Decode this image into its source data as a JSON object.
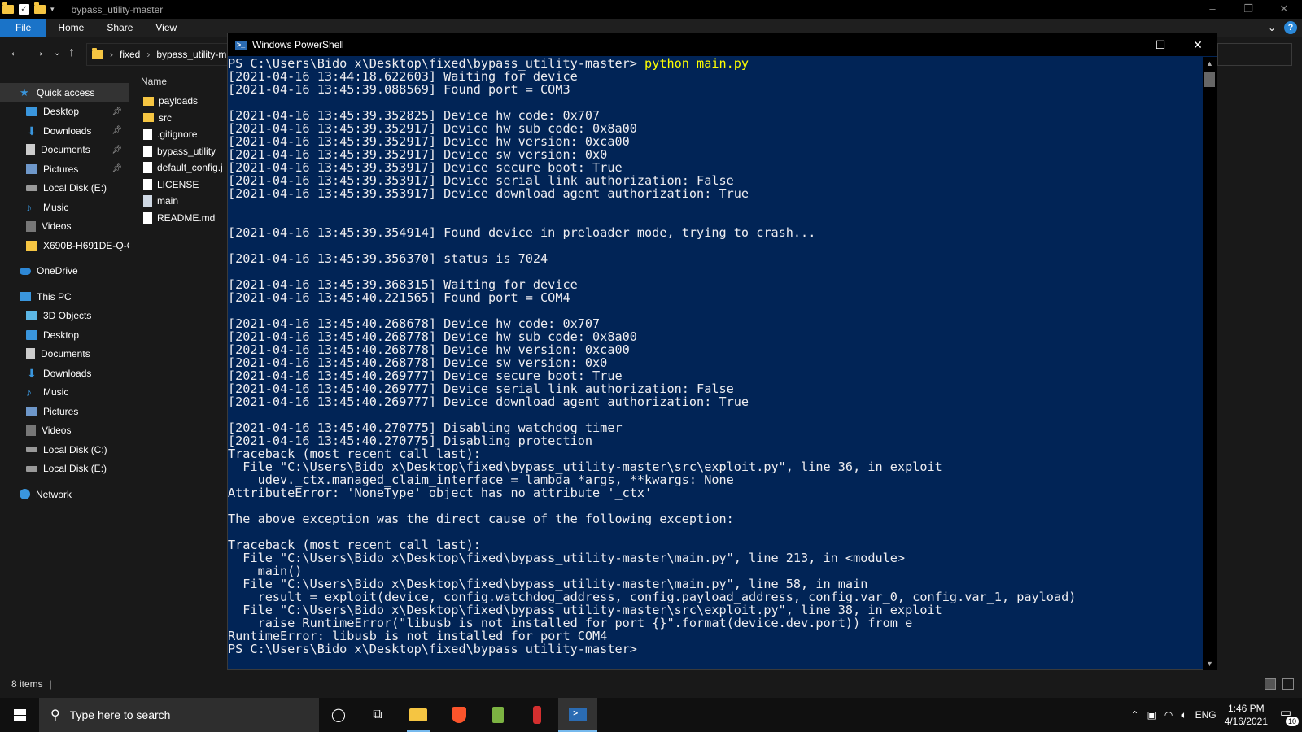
{
  "explorer": {
    "title": "bypass_utility-master",
    "tabs": [
      "File",
      "Home",
      "Share",
      "View"
    ],
    "breadcrumb": [
      "fixed",
      "bypass_utility-m"
    ],
    "column_header": "Name",
    "status_items": "8 items",
    "nav": [
      {
        "label": "Quick access",
        "icon": "star-icon",
        "top": true,
        "selected": true
      },
      {
        "label": "Desktop",
        "icon": "desktop-icon",
        "pin": true
      },
      {
        "label": "Downloads",
        "icon": "downloads-icon",
        "pin": true
      },
      {
        "label": "Documents",
        "icon": "documents-icon",
        "pin": true
      },
      {
        "label": "Pictures",
        "icon": "pictures-icon",
        "pin": true
      },
      {
        "label": "Local Disk (E:)",
        "icon": "disk-icon"
      },
      {
        "label": "Music",
        "icon": "music-icon"
      },
      {
        "label": "Videos",
        "icon": "videos-icon"
      },
      {
        "label": "X690B-H691DE-Q-G",
        "icon": "folder-icon"
      },
      {
        "gap": true
      },
      {
        "label": "OneDrive",
        "icon": "onedrive-icon",
        "top": true
      },
      {
        "gap": true
      },
      {
        "label": "This PC",
        "icon": "this-pc-icon",
        "top": true
      },
      {
        "label": "3D Objects",
        "icon": "3d-objects-icon"
      },
      {
        "label": "Desktop",
        "icon": "desktop-icon"
      },
      {
        "label": "Documents",
        "icon": "documents-icon"
      },
      {
        "label": "Downloads",
        "icon": "downloads-icon"
      },
      {
        "label": "Music",
        "icon": "music-icon"
      },
      {
        "label": "Pictures",
        "icon": "pictures-icon"
      },
      {
        "label": "Videos",
        "icon": "videos-icon"
      },
      {
        "label": "Local Disk (C:)",
        "icon": "disk-icon"
      },
      {
        "label": "Local Disk (E:)",
        "icon": "disk-icon"
      },
      {
        "gap": true
      },
      {
        "label": "Network",
        "icon": "network-icon",
        "top": true
      }
    ],
    "files": [
      {
        "name": "payloads",
        "icon": "folder-icon"
      },
      {
        "name": "src",
        "icon": "folder-icon"
      },
      {
        "name": ".gitignore",
        "icon": "file-icon"
      },
      {
        "name": "bypass_utility",
        "icon": "file-icon"
      },
      {
        "name": "default_config.j",
        "icon": "file-icon"
      },
      {
        "name": "LICENSE",
        "icon": "file-icon"
      },
      {
        "name": "main",
        "icon": "python-file-icon"
      },
      {
        "name": "README.md",
        "icon": "file-icon"
      }
    ]
  },
  "powershell": {
    "title": "Windows PowerShell",
    "prompt_path": "PS C:\\Users\\Bido x\\Desktop\\fixed\\bypass_utility-master> ",
    "command": "python main.py",
    "lines": [
      "[2021-04-16 13:44:18.622603] Waiting for device",
      "[2021-04-16 13:45:39.088569] Found port = COM3",
      "",
      "[2021-04-16 13:45:39.352825] Device hw code: 0x707",
      "[2021-04-16 13:45:39.352917] Device hw sub code: 0x8a00",
      "[2021-04-16 13:45:39.352917] Device hw version: 0xca00",
      "[2021-04-16 13:45:39.352917] Device sw version: 0x0",
      "[2021-04-16 13:45:39.353917] Device secure boot: True",
      "[2021-04-16 13:45:39.353917] Device serial link authorization: False",
      "[2021-04-16 13:45:39.353917] Device download agent authorization: True",
      "",
      "",
      "[2021-04-16 13:45:39.354914] Found device in preloader mode, trying to crash...",
      "",
      "[2021-04-16 13:45:39.356370] status is 7024",
      "",
      "[2021-04-16 13:45:39.368315] Waiting for device",
      "[2021-04-16 13:45:40.221565] Found port = COM4",
      "",
      "[2021-04-16 13:45:40.268678] Device hw code: 0x707",
      "[2021-04-16 13:45:40.268778] Device hw sub code: 0x8a00",
      "[2021-04-16 13:45:40.268778] Device hw version: 0xca00",
      "[2021-04-16 13:45:40.268778] Device sw version: 0x0",
      "[2021-04-16 13:45:40.269777] Device secure boot: True",
      "[2021-04-16 13:45:40.269777] Device serial link authorization: False",
      "[2021-04-16 13:45:40.269777] Device download agent authorization: True",
      "",
      "[2021-04-16 13:45:40.270775] Disabling watchdog timer",
      "[2021-04-16 13:45:40.270775] Disabling protection",
      "Traceback (most recent call last):",
      "  File \"C:\\Users\\Bido x\\Desktop\\fixed\\bypass_utility-master\\src\\exploit.py\", line 36, in exploit",
      "    udev._ctx.managed_claim_interface = lambda *args, **kwargs: None",
      "AttributeError: 'NoneType' object has no attribute '_ctx'",
      "",
      "The above exception was the direct cause of the following exception:",
      "",
      "Traceback (most recent call last):",
      "  File \"C:\\Users\\Bido x\\Desktop\\fixed\\bypass_utility-master\\main.py\", line 213, in <module>",
      "    main()",
      "  File \"C:\\Users\\Bido x\\Desktop\\fixed\\bypass_utility-master\\main.py\", line 58, in main",
      "    result = exploit(device, config.watchdog_address, config.payload_address, config.var_0, config.var_1, payload)",
      "  File \"C:\\Users\\Bido x\\Desktop\\fixed\\bypass_utility-master\\src\\exploit.py\", line 38, in exploit",
      "    raise RuntimeError(\"libusb is not installed for port {}\".format(device.dev.port)) from e",
      "RuntimeError: libusb is not installed for port COM4",
      "PS C:\\Users\\Bido x\\Desktop\\fixed\\bypass_utility-master>"
    ]
  },
  "taskbar": {
    "search_placeholder": "Type here to search",
    "apps": [
      "task-view-icon",
      "file-explorer-icon",
      "brave-icon",
      "app-green-icon",
      "app-red-icon",
      "powershell-icon"
    ],
    "language": "ENG",
    "time": "1:46 PM",
    "date": "4/16/2021",
    "notification_count": "10"
  },
  "colors": {
    "ps_background": "#012456",
    "ps_text": "#eeedf0",
    "ps_command": "#ffff00",
    "accent": "#1a73c8"
  }
}
